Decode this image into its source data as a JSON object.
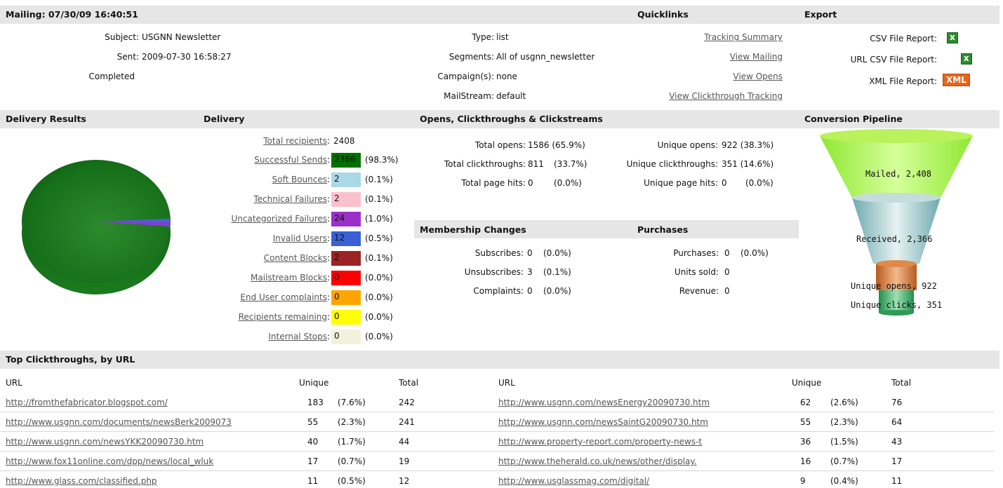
{
  "mailing": {
    "header": "Mailing: 07/30/09 16:40:51",
    "subject_label": "Subject:",
    "subject": "USGNN Newsletter",
    "sent_label": "Sent:",
    "sent": "2009-07-30 16:58:27",
    "status": "Completed",
    "type_label": "Type:",
    "type": "list",
    "segments_label": "Segments:",
    "segments": "All of usgnn_newsletter",
    "campaigns_label": "Campaign(s):",
    "campaigns": "none",
    "mailstream_label": "MailStream:",
    "mailstream": "default"
  },
  "quicklinks": {
    "header": "Quicklinks",
    "links": [
      "Tracking Summary",
      "View Mailing",
      "View Opens",
      "View Clickthrough Tracking"
    ]
  },
  "export": {
    "header": "Export",
    "csv": "CSV File Report:",
    "url_csv": "URL CSV File Report:",
    "xml": "XML File Report:",
    "xml_badge": "XML"
  },
  "delivery_results": {
    "header": "Delivery Results"
  },
  "delivery": {
    "header": "Delivery",
    "total_label": "Total recipients",
    "total_value": "2408",
    "rows": [
      {
        "label": "Successful Sends",
        "value": "2366",
        "pct": "(98.3%)",
        "color": "#007000"
      },
      {
        "label": "Soft Bounces",
        "value": "2",
        "pct": "(0.1%)",
        "color": "#a9d9e6"
      },
      {
        "label": "Technical Failures",
        "value": "2",
        "pct": "(0.1%)",
        "color": "#f9c1cc"
      },
      {
        "label": "Uncategorized Failures",
        "value": "24",
        "pct": "(1.0%)",
        "color": "#9b30c8"
      },
      {
        "label": "Invalid Users",
        "value": "12",
        "pct": "(0.5%)",
        "color": "#3a5fd6"
      },
      {
        "label": "Content Blocks",
        "value": "2",
        "pct": "(0.1%)",
        "color": "#9b2323"
      },
      {
        "label": "Mailstream Blocks",
        "value": "0",
        "pct": "(0.0%)",
        "color": "#ff0000"
      },
      {
        "label": "End User complaints",
        "value": "0",
        "pct": "(0.0%)",
        "color": "#ffa500"
      },
      {
        "label": "Recipients remaining",
        "value": "0",
        "pct": "(0.0%)",
        "color": "#ffff00"
      },
      {
        "label": "Internal Stops",
        "value": "0",
        "pct": "(0.0%)",
        "color": "#f2f2dc"
      }
    ]
  },
  "opens": {
    "header": "Opens, Clickthroughs & Clickstreams",
    "total_opens_label": "Total opens:",
    "total_opens": "1586 (65.9%)",
    "total_clicks_label": "Total clickthroughs:",
    "total_clicks": "811",
    "total_clicks_pct": "(33.7%)",
    "total_hits_label": "Total page hits:",
    "total_hits": "0",
    "total_hits_pct": "(0.0%)",
    "unique_opens_label": "Unique opens:",
    "unique_opens": "922 (38.3%)",
    "unique_clicks_label": "Unique clickthroughs:",
    "unique_clicks": "351 (14.6%)",
    "unique_hits_label": "Unique page hits:",
    "unique_hits": "0",
    "unique_hits_pct": "(0.0%)"
  },
  "membership": {
    "header": "Membership Changes",
    "subscribes_label": "Subscribes:",
    "subscribes": "0",
    "subscribes_pct": "(0.0%)",
    "unsubscribes_label": "Unsubscribes:",
    "unsubscribes": "3",
    "unsubscribes_pct": "(0.1%)",
    "complaints_label": "Complaints:",
    "complaints": "0",
    "complaints_pct": "(0.0%)"
  },
  "purchases": {
    "header": "Purchases",
    "purchases_label": "Purchases:",
    "purchases": "0",
    "purchases_pct": "(0.0%)",
    "units_label": "Units sold:",
    "units": "0",
    "revenue_label": "Revenue:",
    "revenue": "0"
  },
  "pipeline": {
    "header": "Conversion Pipeline",
    "stages": [
      "Mailed, 2,408",
      "Received, 2,366",
      "Unique opens, 922",
      "Unique clicks, 351"
    ]
  },
  "clickthroughs": {
    "header": "Top Clickthroughs, by URL",
    "col_url": "URL",
    "col_unique": "Unique",
    "col_total": "Total",
    "left": [
      {
        "url": "http://fromthefabricator.blogspot.com/",
        "unique": "183",
        "pct": "(7.6%)",
        "total": "242"
      },
      {
        "url": "http://www.usgnn.com/documents/newsBerk2009073",
        "unique": "55",
        "pct": "(2.3%)",
        "total": "241"
      },
      {
        "url": "http://www.usgnn.com/newsYKK20090730.htm",
        "unique": "40",
        "pct": "(1.7%)",
        "total": "44"
      },
      {
        "url": "http://www.fox11online.com/dpp/news/local_wluk",
        "unique": "17",
        "pct": "(0.7%)",
        "total": "19"
      },
      {
        "url": "http://www.glass.com/classified.php",
        "unique": "11",
        "pct": "(0.5%)",
        "total": "12"
      }
    ],
    "right": [
      {
        "url": "http://www.usgnn.com/newsEnergy20090730.htm",
        "unique": "62",
        "pct": "(2.6%)",
        "total": "76"
      },
      {
        "url": "http://www.usgnn.com/newsSaintG20090730.htm",
        "unique": "55",
        "pct": "(2.3%)",
        "total": "64"
      },
      {
        "url": "http://www.property-report.com/property-news-t",
        "unique": "36",
        "pct": "(1.5%)",
        "total": "43"
      },
      {
        "url": "http://www.theherald.co.uk/news/other/display.",
        "unique": "16",
        "pct": "(0.7%)",
        "total": "17"
      },
      {
        "url": "http://www.usglassmag.com/digital/",
        "unique": "9",
        "pct": "(0.4%)",
        "total": "11"
      }
    ]
  },
  "icons": {
    "csv": "excel-icon",
    "url_csv": "excel-icon"
  }
}
